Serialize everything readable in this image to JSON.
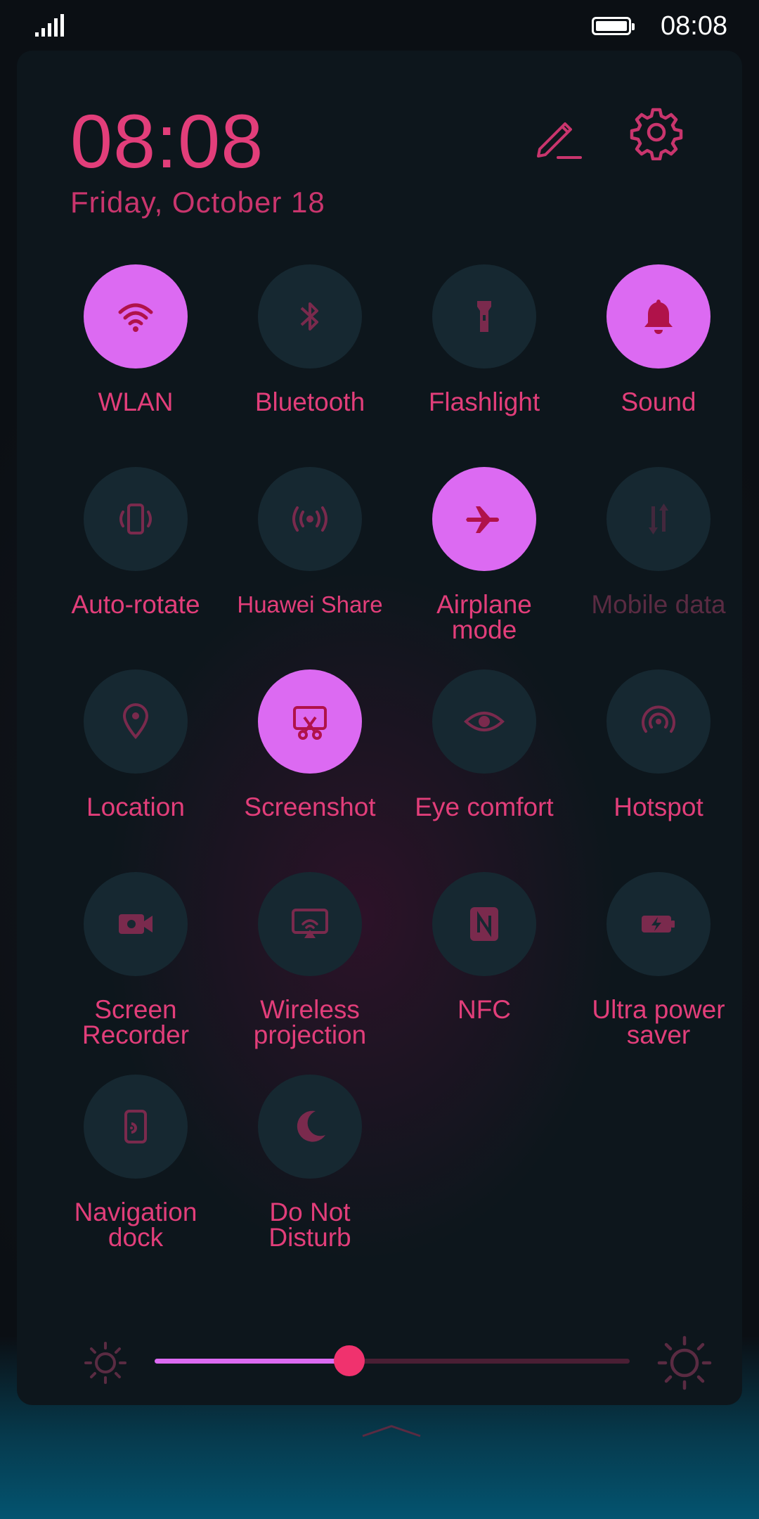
{
  "status_bar": {
    "time": "08:08"
  },
  "header": {
    "time": "08:08",
    "date": "Friday,  October  18"
  },
  "tiles": [
    {
      "label": "WLAN",
      "icon": "wifi-icon",
      "state": "on"
    },
    {
      "label": "Bluetooth",
      "icon": "bluetooth-icon",
      "state": "off"
    },
    {
      "label": "Flashlight",
      "icon": "flashlight-icon",
      "state": "off"
    },
    {
      "label": "Sound",
      "icon": "bell-icon",
      "state": "on"
    },
    {
      "label": "Auto-rotate",
      "icon": "auto-rotate-icon",
      "state": "off"
    },
    {
      "label": "Huawei Share",
      "icon": "huawei-share-icon",
      "state": "off"
    },
    {
      "label": "Airplane\nmode",
      "icon": "airplane-icon",
      "state": "on"
    },
    {
      "label": "Mobile data",
      "icon": "mobile-data-icon",
      "state": "disabled"
    },
    {
      "label": "Location",
      "icon": "location-pin-icon",
      "state": "off"
    },
    {
      "label": "Screenshot",
      "icon": "screenshot-icon",
      "state": "on"
    },
    {
      "label": "Eye comfort",
      "icon": "eye-icon",
      "state": "off"
    },
    {
      "label": "Hotspot",
      "icon": "hotspot-icon",
      "state": "off"
    },
    {
      "label": "Screen\nRecorder",
      "icon": "video-camera-icon",
      "state": "off"
    },
    {
      "label": "Wireless\nprojection",
      "icon": "wireless-projection-icon",
      "state": "off"
    },
    {
      "label": "NFC",
      "icon": "nfc-icon",
      "state": "off"
    },
    {
      "label": "Ultra power\nsaver",
      "icon": "battery-bolt-icon",
      "state": "off"
    },
    {
      "label": "Navigation\ndock",
      "icon": "navigation-dock-icon",
      "state": "off"
    },
    {
      "label": "Do Not\nDisturb",
      "icon": "moon-icon",
      "state": "off"
    }
  ],
  "brightness": {
    "level": 0.41
  },
  "colors": {
    "accent": "#e23e7a",
    "tile_on": "#dc6af2",
    "tile_off": "#162831",
    "thumb": "#f0326e"
  }
}
